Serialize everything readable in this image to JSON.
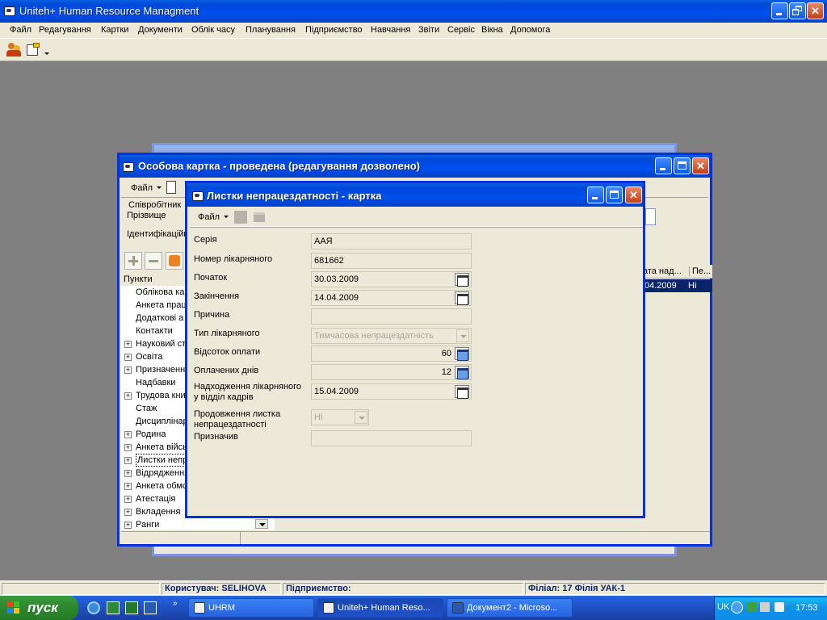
{
  "app": {
    "title": "Uniteh+ Human Resource Managment",
    "menu": [
      "Файл",
      "Редагування",
      "Картки",
      "Документи",
      "Облік часу",
      "Планування",
      "Підприємство",
      "Навчання",
      "Звіти",
      "Сервіс",
      "Вікна",
      "Допомога"
    ]
  },
  "person_window": {
    "title": "Особова картка - проведена (редагування дозволено)",
    "file_menu": "Файл",
    "labels": {
      "employee": "Співробітник",
      "surname": "Прізвище",
      "ident": "Ідентифікаційн"
    },
    "tree_header": "Пункти",
    "tree": [
      {
        "label": "Облікова ка",
        "expandable": false
      },
      {
        "label": "Анкета праці",
        "expandable": false
      },
      {
        "label": "Додаткові а",
        "expandable": false
      },
      {
        "label": "Контакти",
        "expandable": false
      },
      {
        "label": "Науковий ст",
        "expandable": true
      },
      {
        "label": "Освіта",
        "expandable": true
      },
      {
        "label": "Призначенн",
        "expandable": true
      },
      {
        "label": "Надбавки",
        "expandable": false
      },
      {
        "label": "Трудова кни",
        "expandable": true
      },
      {
        "label": "Стаж",
        "expandable": false
      },
      {
        "label": "Дисциплінар",
        "expandable": false
      },
      {
        "label": "Родина",
        "expandable": true
      },
      {
        "label": "Анкета військ",
        "expandable": true
      },
      {
        "label": "Листки непр",
        "expandable": true
      },
      {
        "label": "Відрядження",
        "expandable": true
      },
      {
        "label": "Анкета обмс",
        "expandable": true
      },
      {
        "label": "Атестація",
        "expandable": true
      },
      {
        "label": "Вкладення",
        "expandable": true
      },
      {
        "label": "Ранги",
        "expandable": true
      }
    ],
    "grid": {
      "columns": [
        "ата над...",
        "Пе..."
      ],
      "row": [
        "04.2009",
        "Ні"
      ]
    }
  },
  "sick_window": {
    "title": "Листки непрацездатності - картка",
    "file_menu": "Файл",
    "fields": {
      "series": {
        "label": "Серія",
        "value": "ААЯ"
      },
      "number": {
        "label": "Номер лікарняного",
        "value": "681662"
      },
      "start": {
        "label": "Початок",
        "value": "30.03.2009"
      },
      "end": {
        "label": "Закінчення",
        "value": "14.04.2009"
      },
      "reason": {
        "label": "Причина",
        "value": ""
      },
      "type": {
        "label": "Тип лікарняного",
        "value": "Тимчасова непрацездатність"
      },
      "percent": {
        "label": "Відсоток оплати",
        "value": "60"
      },
      "days": {
        "label": "Оплачених днів",
        "value": "12"
      },
      "received_l1": "Надходження лікарняного",
      "received_l2": "у відділ кадрів",
      "received": {
        "value": "15.04.2009"
      },
      "continuation_l1": "Продовження листка",
      "continuation_l2": "непрацездатності",
      "continuation": {
        "value": "Ні"
      },
      "assigned": {
        "label": "Призначив",
        "value": ""
      }
    }
  },
  "status": {
    "user": "Користувач: SELIHOVA",
    "company": "Підприємство:",
    "branch": "Філіал: 17 Філія УАК-1"
  },
  "taskbar": {
    "start": "пуск",
    "tasks": [
      "UHRM",
      "Uniteh+ Human Reso...",
      "Документ2 - Microso..."
    ],
    "lang": "UK",
    "clock": "17:53"
  }
}
